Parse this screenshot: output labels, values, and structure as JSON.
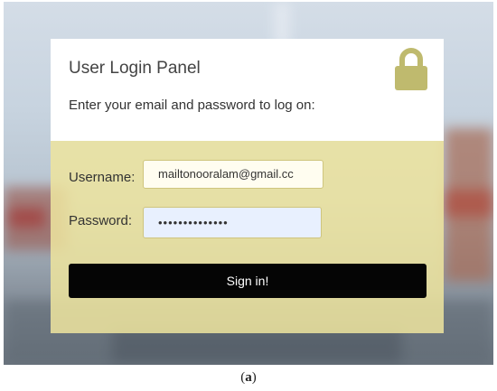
{
  "panel": {
    "title": "User Login Panel",
    "subtitle": "Enter your email and password to log on:",
    "icon": "lock-icon",
    "accent": "#bfba6e"
  },
  "form": {
    "username_label": "Username:",
    "username_value": "mailtonooralam@gmail.cc",
    "password_label": "Password:",
    "password_value": "••••••••••••••",
    "signin_label": "Sign in!"
  },
  "caption": {
    "open": "(",
    "letter": "a",
    "close": ")"
  }
}
